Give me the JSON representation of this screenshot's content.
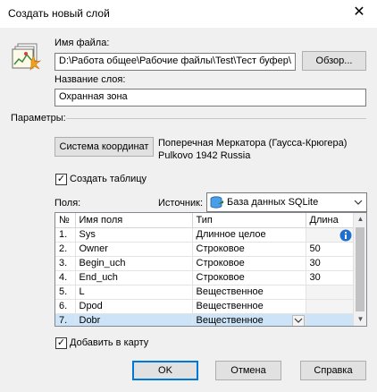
{
  "window": {
    "title": "Создать новый слой",
    "close_icon": "close-icon"
  },
  "file": {
    "label": "Имя файла:",
    "value": "D:\\Работа общее\\Рабочие файлы\\Test\\Тест буфер\\",
    "browse_label": "Обзор..."
  },
  "layer": {
    "label": "Название слоя:",
    "value": "Охранная зона"
  },
  "params": {
    "label": "Параметры:",
    "coord_button": "Система координат",
    "coord_line1": "Поперечная Меркатора (Гаусса-Крюгера)",
    "coord_line2": "Pulkovo 1942 Russia"
  },
  "create_table": {
    "label": "Создать таблицу",
    "checked": true
  },
  "fields": {
    "label": "Поля:",
    "source_label": "Источник:",
    "source_value": "База данных SQLite",
    "columns": [
      "№",
      "Имя поля",
      "Тип",
      "Длина"
    ],
    "rows": [
      {
        "num": "1.",
        "name": "Sys",
        "type": "Длинное целое",
        "len": ""
      },
      {
        "num": "2.",
        "name": "Owner",
        "type": "Строковое",
        "len": "50"
      },
      {
        "num": "3.",
        "name": "Begin_uch",
        "type": "Строковое",
        "len": "30"
      },
      {
        "num": "4.",
        "name": "End_uch",
        "type": "Строковое",
        "len": "30"
      },
      {
        "num": "5.",
        "name": "L",
        "type": "Вещественное",
        "len": ""
      },
      {
        "num": "6.",
        "name": "Dpod",
        "type": "Вещественное",
        "len": ""
      },
      {
        "num": "7.",
        "name": "Dobr",
        "type": "Вещественное",
        "len": ""
      }
    ]
  },
  "add_to_map": {
    "label": "Добавить в карту",
    "checked": true
  },
  "buttons": {
    "ok": "OK",
    "cancel": "Отмена",
    "help": "Справка"
  },
  "colors": {
    "accent": "#0078d7",
    "info": "#1e6fd0",
    "selected_row": "#cde3f7"
  }
}
